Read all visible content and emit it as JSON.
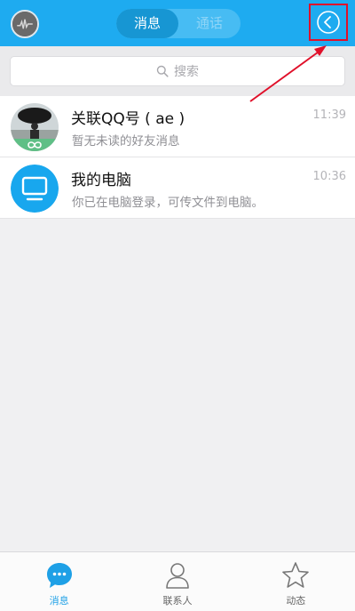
{
  "header": {
    "tabs": [
      {
        "label": "消息",
        "active": true
      },
      {
        "label": "通话",
        "active": false
      }
    ],
    "back_icon": "chevron-left-icon"
  },
  "search": {
    "placeholder": "搜索",
    "icon": "search-icon"
  },
  "conversations": [
    {
      "title": "关联QQ号 ( ae )",
      "subtitle": "暂无未读的好友消息",
      "time": "11:39",
      "avatar": "linked-account-avatar"
    },
    {
      "title": "我的电脑",
      "subtitle": "你已在电脑登录，可传文件到电脑。",
      "time": "10:36",
      "avatar": "computer-icon"
    }
  ],
  "tabbar": {
    "items": [
      {
        "label": "消息",
        "icon": "message-bubble-icon",
        "active": true
      },
      {
        "label": "联系人",
        "icon": "contacts-icon",
        "active": false
      },
      {
        "label": "动态",
        "icon": "star-icon",
        "active": false
      }
    ]
  },
  "colors": {
    "header_bg": "#1eabf0",
    "accent": "#1ea0e6",
    "annotation": "#e0102a"
  }
}
